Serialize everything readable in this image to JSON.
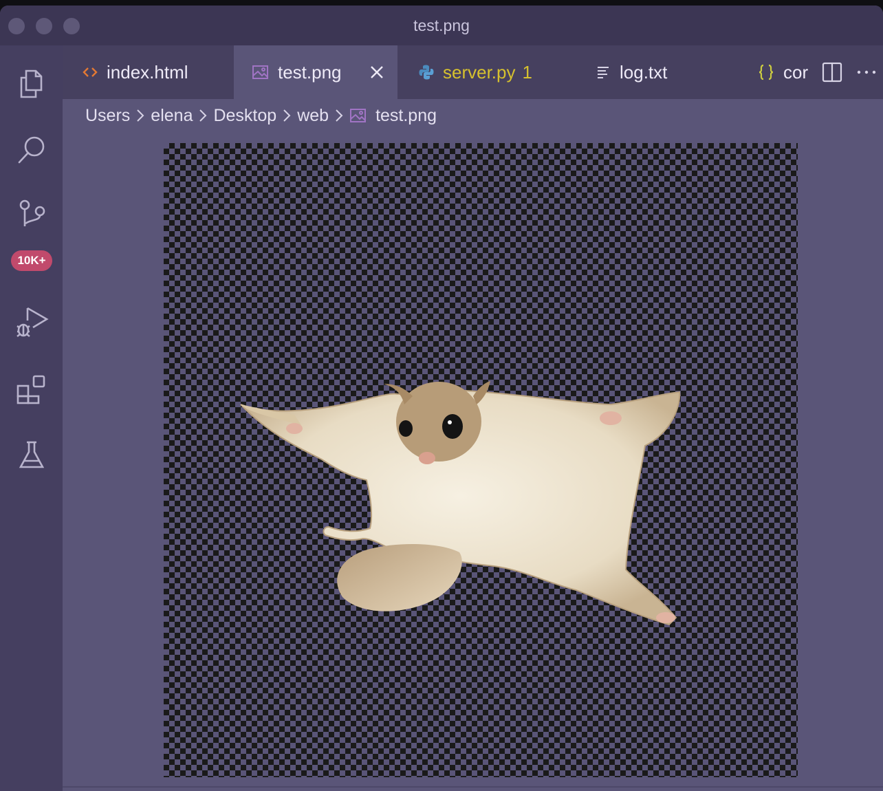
{
  "window": {
    "title": "test.png"
  },
  "activity_bar": {
    "items": [
      {
        "name": "explorer",
        "icon": "files-icon"
      },
      {
        "name": "search",
        "icon": "search-icon"
      },
      {
        "name": "source-control",
        "icon": "source-control-icon",
        "badge": "10K+"
      },
      {
        "name": "run-and-debug",
        "icon": "run-debug-icon"
      },
      {
        "name": "extensions",
        "icon": "extensions-icon"
      },
      {
        "name": "testing",
        "icon": "flask-icon"
      }
    ]
  },
  "tabs": [
    {
      "label": "index.html",
      "icon": "html-brackets-icon",
      "icon_color": "#e37933"
    },
    {
      "label": "test.png",
      "icon": "image-icon",
      "icon_color": "#a074c4",
      "active": true
    },
    {
      "label": "server.py",
      "icon": "python-icon",
      "problems": "1",
      "label_color": "#d6c12e"
    },
    {
      "label": "log.txt",
      "icon": "text-lines-icon"
    },
    {
      "label": "cor",
      "icon": "json-braces-icon",
      "icon_color": "#cbcb41"
    }
  ],
  "breadcrumb": {
    "items": [
      "Users",
      "elena",
      "Desktop",
      "web"
    ],
    "file": "test.png"
  },
  "colors": {
    "editor_bg": "#5a5578",
    "activity_bg": "#453f60",
    "tab_bar_bg": "#46405f",
    "badge_bg": "#c14a6c"
  }
}
